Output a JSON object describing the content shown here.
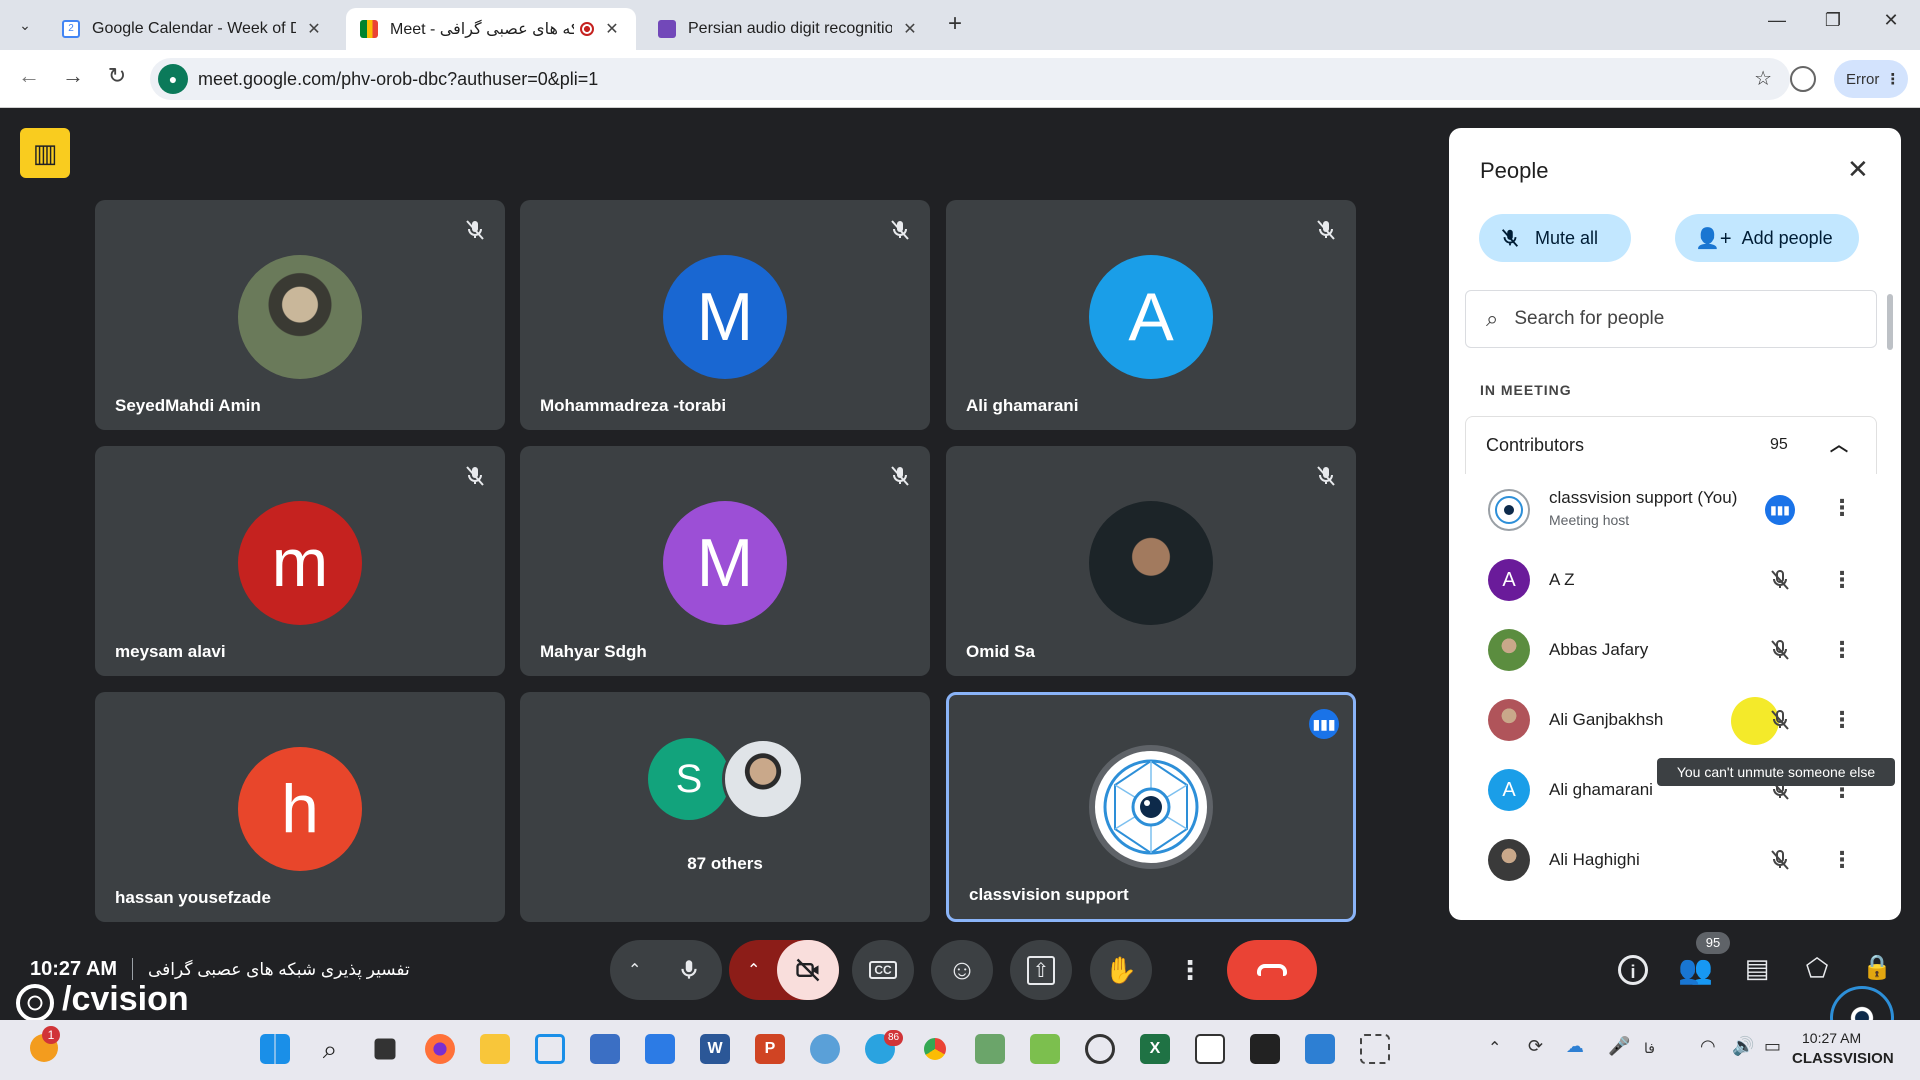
{
  "browser": {
    "tabs": [
      {
        "title": "Google Calendar - Week of Dec",
        "favicon": "calendar-icon"
      },
      {
        "title": "Meet - شبکه های عصبی گرافی",
        "favicon": "meet-icon"
      },
      {
        "title": "Persian audio digit recognition",
        "favicon": "doc-icon"
      }
    ],
    "url": "meet.google.com/phv-orob-dbc?authuser=0&pli=1",
    "profile_label": "Error"
  },
  "tiles": [
    {
      "name": "SeyedMahdi Amin",
      "initial": "",
      "color": "#5f6b4f",
      "muted": true
    },
    {
      "name": "Mohammadreza -torabi",
      "initial": "M",
      "color": "#1967d2",
      "muted": true
    },
    {
      "name": "Ali ghamarani",
      "initial": "A",
      "color": "#1a9ee8",
      "muted": true
    },
    {
      "name": "meysam alavi",
      "initial": "m",
      "color": "#c5221f",
      "muted": true
    },
    {
      "name": "Mahyar Sdgh",
      "initial": "M",
      "color": "#9c4fd6",
      "muted": true
    },
    {
      "name": "Omid Sa",
      "initial": "",
      "color": "#2b3438",
      "muted": true
    },
    {
      "name": "hassan yousefzade",
      "initial": "h",
      "color": "#e8462b",
      "muted": false
    },
    {
      "name": "87 others",
      "initial": "S",
      "color": "#12a37c",
      "muted": false
    },
    {
      "name": "classvision support",
      "initial": "",
      "color": "#ffffff",
      "muted": false
    }
  ],
  "people_panel": {
    "title": "People",
    "mute_all": "Mute all",
    "add_people": "Add people",
    "search_placeholder": "Search for people",
    "section": "IN MEETING",
    "group_label": "Contributors",
    "group_count": "95",
    "participants": [
      {
        "name": "classvision support (You)",
        "subtitle": "Meeting host",
        "initial": "",
        "color": "#ffffff"
      },
      {
        "name": "A Z",
        "subtitle": "",
        "initial": "A",
        "color": "#6a1b9a"
      },
      {
        "name": "Abbas Jafary",
        "subtitle": "",
        "initial": "",
        "color": "#6b8f5a"
      },
      {
        "name": "Ali Ganjbakhsh",
        "subtitle": "",
        "initial": "",
        "color": "#b0545a"
      },
      {
        "name": "Ali ghamarani",
        "subtitle": "",
        "initial": "A",
        "color": "#1a9ee8"
      },
      {
        "name": "Ali Haghighi",
        "subtitle": "",
        "initial": "",
        "color": "#4a4a4a"
      }
    ],
    "tooltip": "You can't unmute someone else"
  },
  "bottom": {
    "time": "10:27 AM",
    "meeting_title": "تفسیر پذیری شبکه های عصبی گرافی",
    "watermark": "/cvision",
    "people_badge": "95"
  },
  "taskbar": {
    "clock": "10:27 AM",
    "brand": "CLASSVISION",
    "lang": "فا",
    "notify_badge": "1",
    "telegram_badge": "86"
  }
}
